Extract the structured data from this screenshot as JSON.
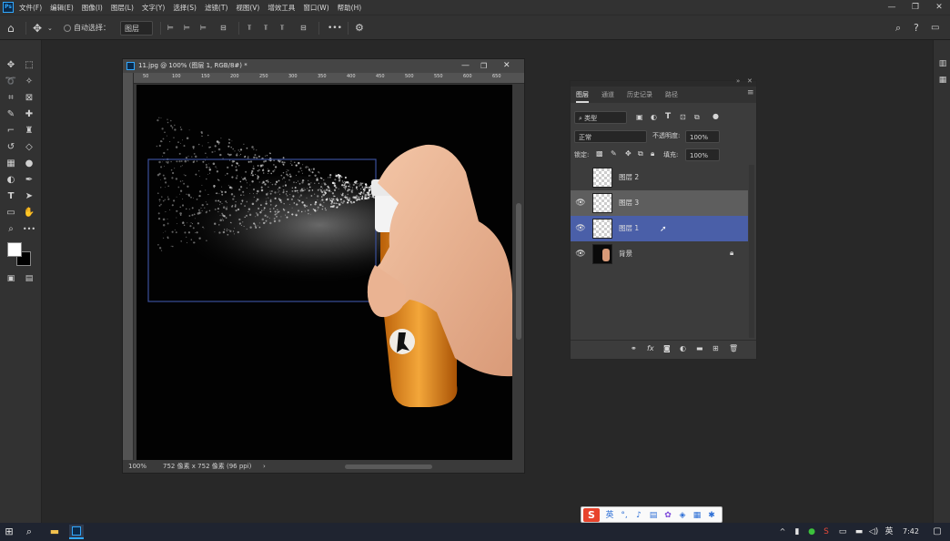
{
  "app": {
    "logo": "Ps",
    "menu": [
      "文件(F)",
      "编辑(E)",
      "图像(I)",
      "图层(L)",
      "文字(Y)",
      "选择(S)",
      "滤镜(T)",
      "视图(V)",
      "增效工具",
      "窗口(W)",
      "帮助(H)"
    ],
    "window_controls": [
      "—",
      "❐",
      "✕"
    ]
  },
  "options_bar": {
    "auto_select_label": "自动选择：",
    "auto_select_target": "图层",
    "more": "•••"
  },
  "toolbar": {
    "icons": [
      "move-tool-icon",
      "marquee-tool-icon",
      "lasso-tool-icon",
      "magic-wand-icon",
      "crop-tool-icon",
      "frame-tool-icon",
      "eyedropper-icon",
      "healing-brush-icon",
      "brush-tool-icon",
      "clone-stamp-icon",
      "history-brush-icon",
      "eraser-icon",
      "gradient-icon",
      "blur-icon",
      "dodge-icon",
      "pen-tool-icon",
      "type-tool-icon",
      "path-selection-icon",
      "rectangle-tool-icon",
      "hand-tool-icon",
      "zoom-tool-icon",
      "more-tools-icon"
    ]
  },
  "document": {
    "title": "11.jpg @ 100% (图层 1, RGB/8#) *",
    "zoom": "100%",
    "doc_info": "752 像素 x 752 像素 (96 ppi)",
    "ruler_marks": [
      "50",
      "100",
      "150",
      "200",
      "250",
      "300",
      "350",
      "400",
      "450",
      "500",
      "550",
      "600",
      "650"
    ]
  },
  "layers_panel": {
    "tabs": [
      "图层",
      "通道",
      "历史记录",
      "路径"
    ],
    "filter_kind": "类型",
    "blend_mode": "正常",
    "opacity_label": "不透明度:",
    "opacity_value": "100%",
    "lock_label": "锁定:",
    "fill_label": "填充:",
    "fill_value": "100%",
    "layers": [
      {
        "name": "图层 2",
        "visible": false,
        "selected": false
      },
      {
        "name": "图层 3",
        "visible": true,
        "selected": false,
        "highlight": true
      },
      {
        "name": "图层 1",
        "visible": true,
        "selected": true
      },
      {
        "name": "背景",
        "visible": true,
        "selected": false,
        "locked": true
      }
    ],
    "footer_icons": [
      "link-icon",
      "fx-icon",
      "mask-icon",
      "adjustment-icon",
      "group-icon",
      "new-layer-icon",
      "trash-icon"
    ]
  },
  "ime": {
    "logo": "S",
    "lang": "英"
  },
  "taskbar": {
    "time": "7:42",
    "lang": "英"
  }
}
